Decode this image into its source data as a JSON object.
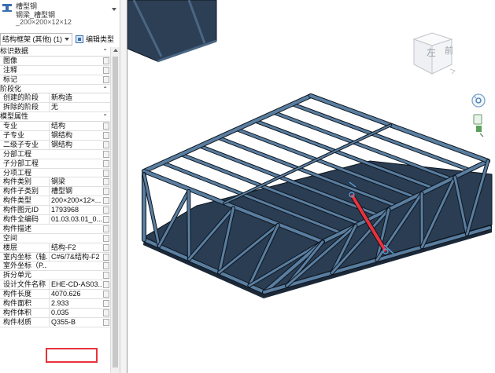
{
  "type_selector": {
    "line1": "槽型钢",
    "line2": "钢梁_槽型钢",
    "line3": "_200×200×12×12"
  },
  "filter": {
    "selected": "结构框架 (其他) (1)",
    "edit_type_label": "编辑类型"
  },
  "sections": {
    "identity": "标识数据",
    "phasing": "阶段化",
    "model_props": "模型属性"
  },
  "identity_rows": [
    {
      "key": "图像",
      "value": ""
    },
    {
      "key": "注释",
      "value": ""
    },
    {
      "key": "标记",
      "value": ""
    }
  ],
  "phasing_rows": [
    {
      "key": "创建的阶段",
      "value": "新构造"
    },
    {
      "key": "拆除的阶段",
      "value": "无"
    }
  ],
  "model_rows": [
    {
      "key": "专业",
      "value": "结构"
    },
    {
      "key": "子专业",
      "value": "钢结构"
    },
    {
      "key": "二级子专业",
      "value": "钢结构"
    },
    {
      "key": "分部工程",
      "value": ""
    },
    {
      "key": "子分部工程",
      "value": ""
    },
    {
      "key": "分项工程",
      "value": ""
    },
    {
      "key": "构件类别",
      "value": "钢梁"
    },
    {
      "key": "构件子类别",
      "value": "槽型钢"
    },
    {
      "key": "构件类型",
      "value": "200×200×12×..."
    },
    {
      "key": "构件图元ID",
      "value": "1793968"
    },
    {
      "key": "构件全编码",
      "value": "01.03.03.01_0..."
    },
    {
      "key": "构件描述",
      "value": ""
    },
    {
      "key": "空间",
      "value": ""
    },
    {
      "key": "楼层",
      "value": "结构-F2"
    },
    {
      "key": "室内坐标（轴...",
      "value": "C#6/7&结构-F2"
    },
    {
      "key": "室外坐标（P...",
      "value": ""
    },
    {
      "key": "拆分单元",
      "value": ""
    },
    {
      "key": "设计文件名称",
      "value": "EHE-CD-AS03..."
    },
    {
      "key": "构件长度",
      "value": "4070.626"
    },
    {
      "key": "构件面积",
      "value": "2.933"
    },
    {
      "key": "构件体积",
      "value": "0.035"
    },
    {
      "key": "构件材质",
      "value": "Q355-B"
    }
  ],
  "viewcube": {
    "left_label": "左",
    "front_label": "前"
  },
  "colors": {
    "steel": "#2c3f55",
    "steel_edge": "#0e1620",
    "steel_light": "#5a7ea0",
    "selected": "#e8323c",
    "highlight_box": "#e8323c"
  }
}
